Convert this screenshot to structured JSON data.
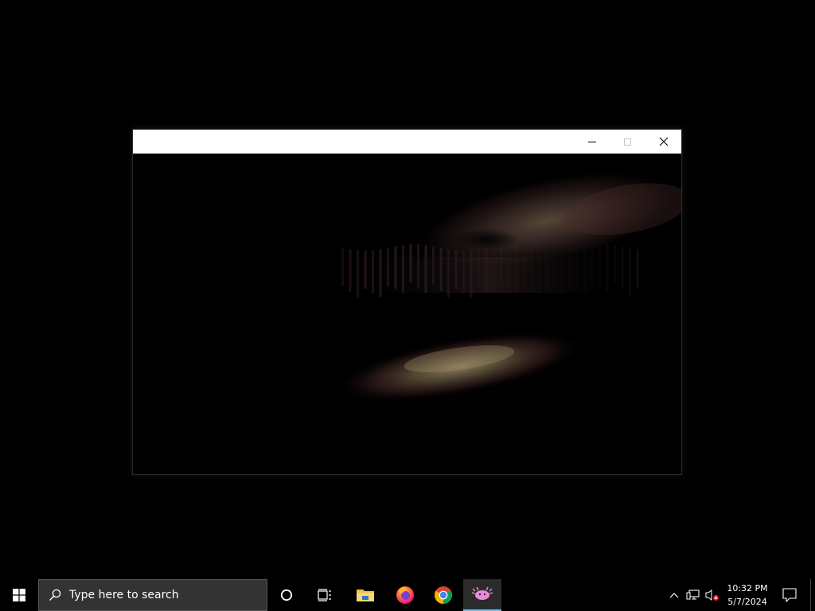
{
  "window": {
    "title": "",
    "caption_buttons": [
      "minimize",
      "maximize",
      "close"
    ],
    "content_background": "#000000"
  },
  "taskbar": {
    "search_placeholder": "Type here to search",
    "apps": [
      {
        "name": "cortana",
        "icon": "circle-icon"
      },
      {
        "name": "task-view",
        "icon": "task-view-icon"
      },
      {
        "name": "file-explorer",
        "icon": "folder-icon"
      },
      {
        "name": "firefox",
        "icon": "firefox-icon"
      },
      {
        "name": "chrome",
        "icon": "chrome-icon"
      },
      {
        "name": "running-app",
        "icon": "pink-creature-icon",
        "active": true
      }
    ],
    "active_indicator_color": "#76b9ed"
  },
  "tray": {
    "time": "10:32 PM",
    "date": "5/7/2024",
    "volume_muted": true
  }
}
